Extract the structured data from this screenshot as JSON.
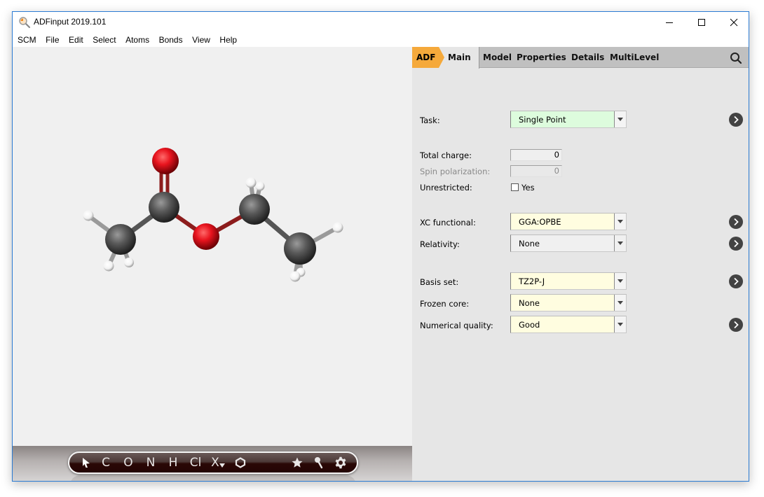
{
  "window": {
    "title": "ADFinput 2019.101",
    "controls": {
      "minimize": "minimize",
      "maximize": "maximize",
      "close": "close"
    }
  },
  "menubar": {
    "items": [
      "SCM",
      "File",
      "Edit",
      "Select",
      "Atoms",
      "Bonds",
      "View",
      "Help"
    ]
  },
  "viewer": {
    "molecule": "ethyl acetate",
    "atom_colors": {
      "C": "#4a4a4a",
      "O": "#e8141e",
      "H": "#ffffff"
    },
    "bond_colors": {
      "C-C": "#555555",
      "C-O": "#8c1c1c",
      "C-H": "#aaaaaa"
    }
  },
  "toolbar": {
    "items": [
      {
        "id": "select",
        "label": "",
        "icon": "arrow-cursor-icon"
      },
      {
        "id": "C",
        "label": "C"
      },
      {
        "id": "O",
        "label": "O"
      },
      {
        "id": "N",
        "label": "N"
      },
      {
        "id": "H",
        "label": "H"
      },
      {
        "id": "Cl",
        "label": "Cl"
      },
      {
        "id": "X",
        "label": "X"
      },
      {
        "id": "ring",
        "label": "",
        "icon": "hexagon-icon"
      },
      {
        "id": "favorites",
        "label": "",
        "icon": "star-icon"
      },
      {
        "id": "tools",
        "label": "",
        "icon": "pin-icon"
      },
      {
        "id": "settings",
        "label": "",
        "icon": "gear-icon"
      }
    ]
  },
  "panel": {
    "tabs": {
      "engine": "ADF",
      "items": [
        "Main",
        "Model",
        "Properties",
        "Details",
        "MultiLevel"
      ],
      "active": "Main"
    },
    "accent_color": "#f5a93b",
    "fields": {
      "task": {
        "label": "Task:",
        "value": "Single Point"
      },
      "total_charge": {
        "label": "Total charge:",
        "value": "0"
      },
      "spin_polarization": {
        "label": "Spin polarization:",
        "value": "0"
      },
      "unrestricted": {
        "label": "Unrestricted:",
        "option": "Yes",
        "checked": false
      },
      "xc_functional": {
        "label": "XC functional:",
        "value": "GGA:OPBE"
      },
      "relativity": {
        "label": "Relativity:",
        "value": "None"
      },
      "basis_set": {
        "label": "Basis set:",
        "value": "TZ2P-J"
      },
      "frozen_core": {
        "label": "Frozen core:",
        "value": "None"
      },
      "numerical_quality": {
        "label": "Numerical quality:",
        "value": "Good"
      }
    }
  }
}
